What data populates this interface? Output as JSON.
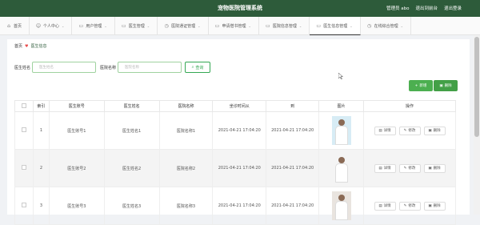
{
  "header": {
    "title": "宠物医院管理系统",
    "user_label": "管理员 abo",
    "goto_front": "退出到前台",
    "logout": "退出登录"
  },
  "tabs": [
    {
      "label": "首页",
      "icon": "home-icon"
    },
    {
      "label": "个人中心",
      "icon": "user-icon"
    },
    {
      "label": "用户管理",
      "icon": "folder-icon"
    },
    {
      "label": "医生管理",
      "icon": "folder-icon"
    },
    {
      "label": "医院通证管理",
      "icon": "clock-icon"
    },
    {
      "label": "申请僧书管理",
      "icon": "folder-icon"
    },
    {
      "label": "医院信息管理",
      "icon": "folder-icon"
    },
    {
      "label": "医生信息管理",
      "icon": "folder-icon"
    },
    {
      "label": "在线综合管理",
      "icon": "clock-icon"
    }
  ],
  "breadcrumb": {
    "home": "首页",
    "current": "医生信息"
  },
  "search": {
    "doctor_label": "医生姓名",
    "doctor_placeholder": "医生姓名",
    "hospital_label": "医院名称",
    "hospital_placeholder": "医院名称",
    "button": "查询"
  },
  "actions": {
    "add": "新增",
    "delete": "删除"
  },
  "table": {
    "headers": [
      "",
      "索引",
      "医生账号",
      "医生姓名",
      "医院名称",
      "坐诊时间从",
      "到",
      "图片",
      "操作"
    ],
    "rows": [
      {
        "index": "1",
        "account": "医生账号1",
        "name": "医生姓名1",
        "hospital": "医院名称1",
        "from": "2021-04-21 17:04:20",
        "to": "2021-04-21 17:04:20"
      },
      {
        "index": "2",
        "account": "医生账号2",
        "name": "医生姓名2",
        "hospital": "医院名称2",
        "from": "2021-04-21 17:04:20",
        "to": "2021-04-21 17:04:20"
      },
      {
        "index": "3",
        "account": "医生账号3",
        "name": "医生姓名3",
        "hospital": "医院名称3",
        "from": "2021-04-21 17:04:20",
        "to": "2021-04-21 17:04:20"
      }
    ],
    "ops": {
      "detail": "详情",
      "edit": "修改",
      "delete": "删除"
    }
  },
  "colors": {
    "topbar": "#2d5b3a",
    "accent": "#4caf50"
  }
}
